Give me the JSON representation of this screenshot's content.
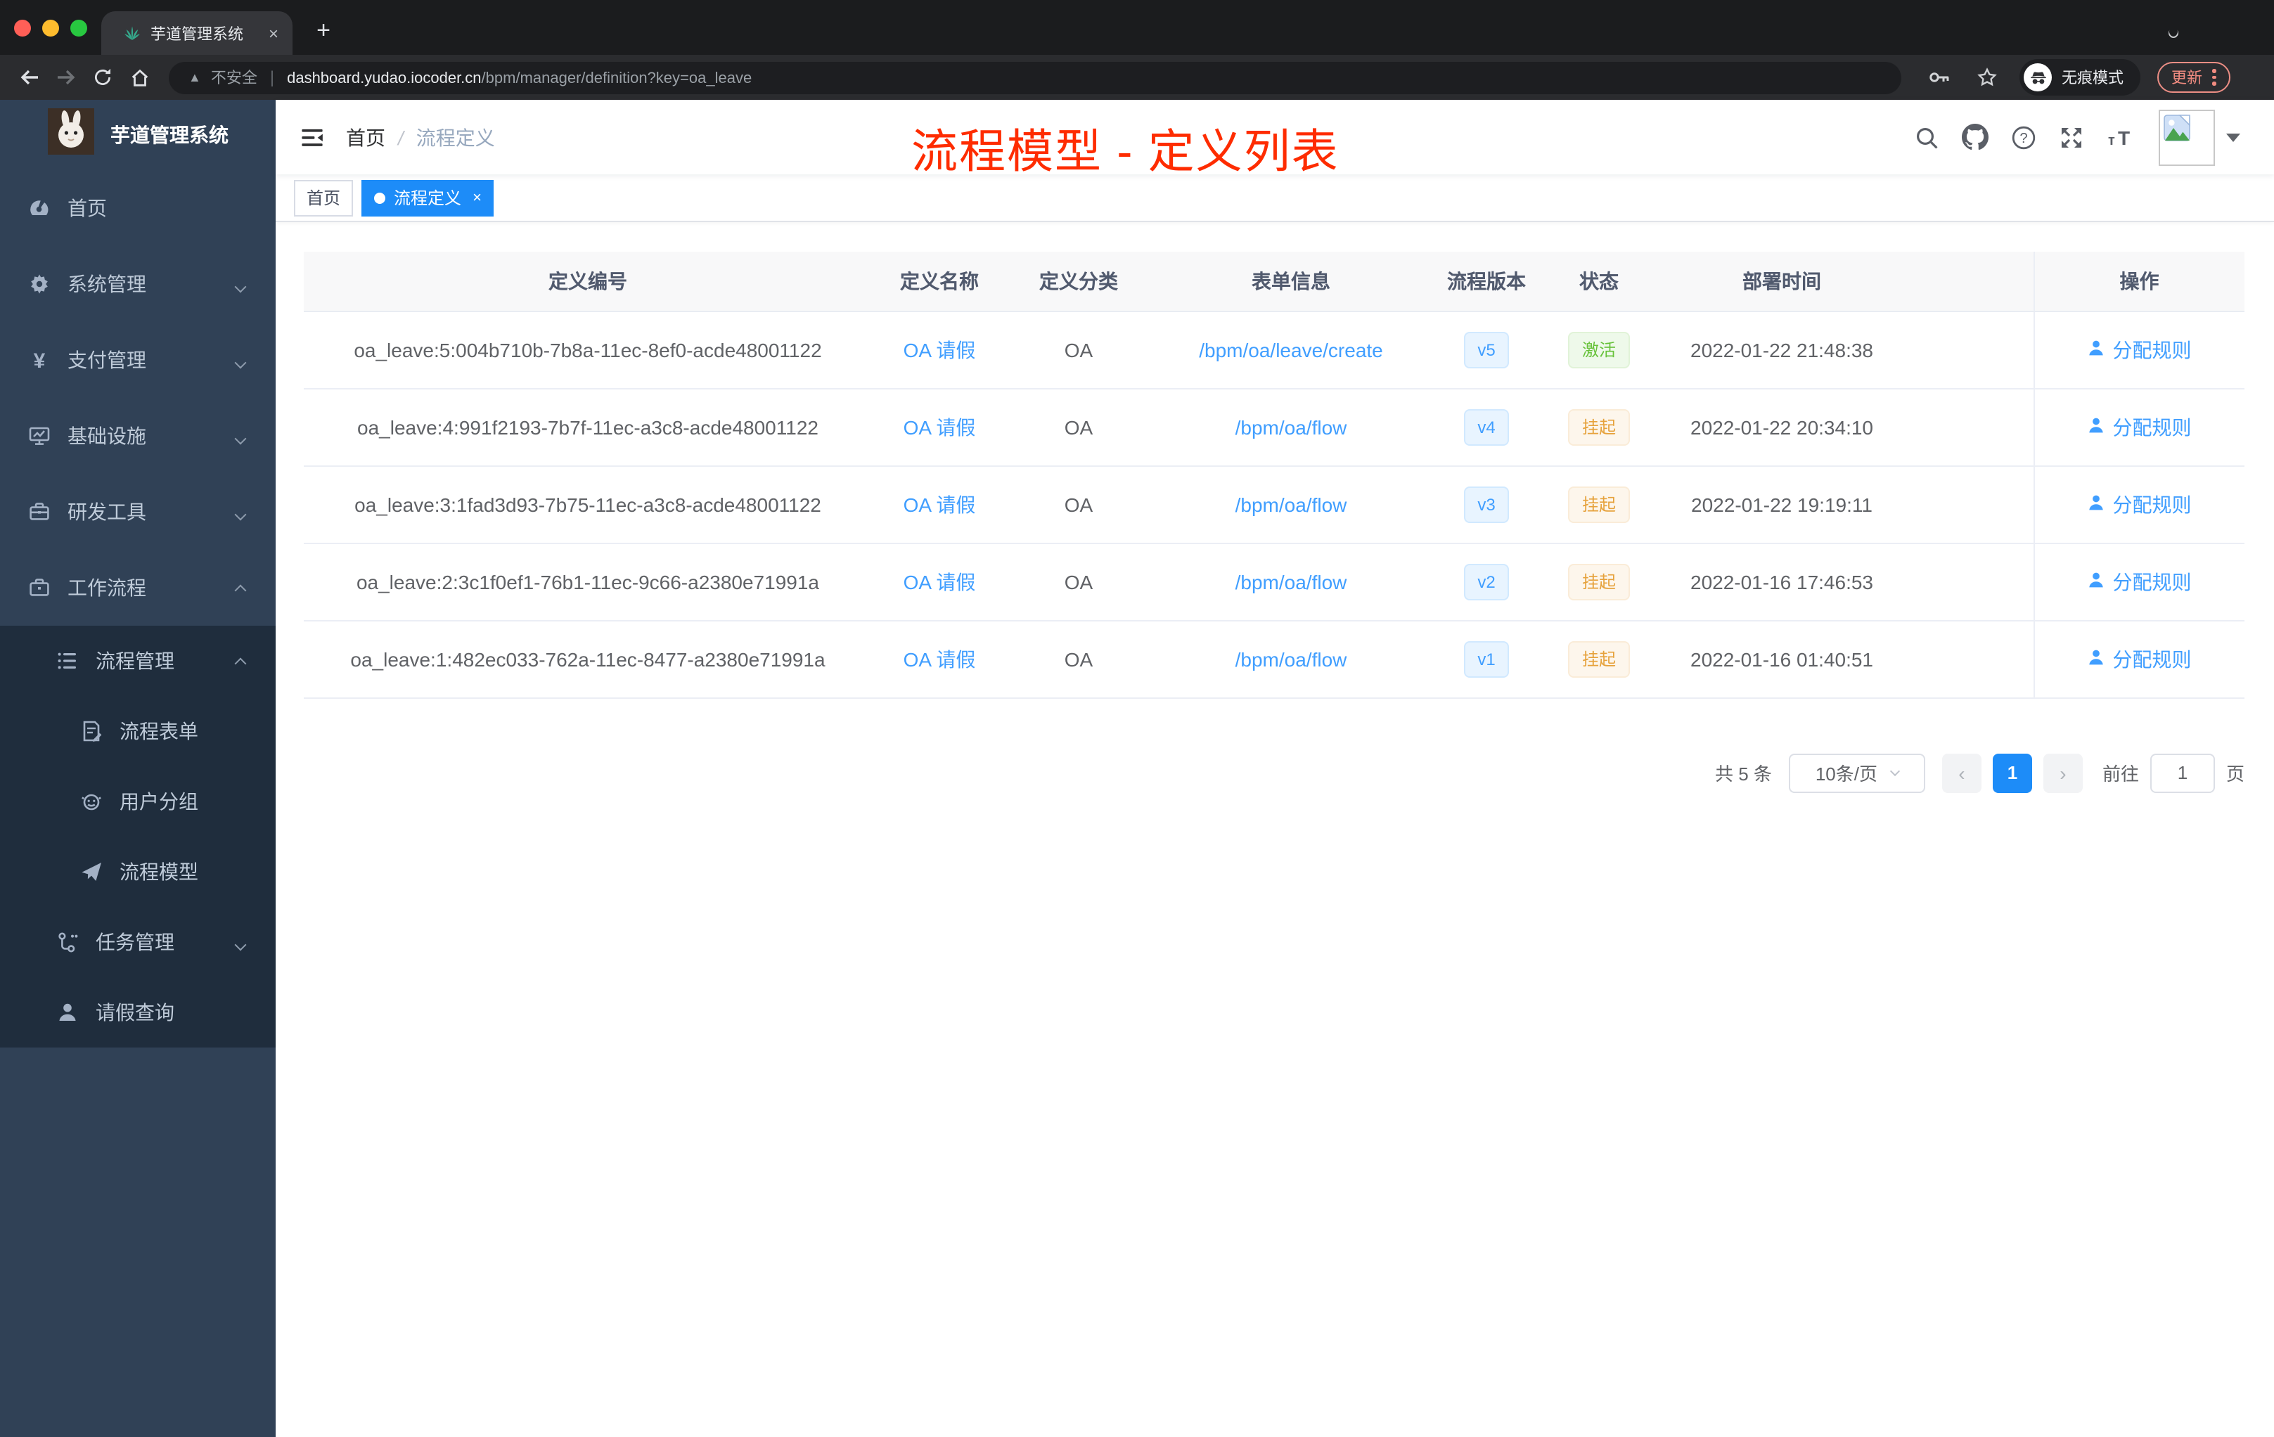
{
  "browser": {
    "tab": {
      "title": "芋道管理系统",
      "close": "×",
      "new_tab": "+"
    },
    "address": {
      "warning_glyph": "▲",
      "security": "不安全",
      "separator": "|",
      "domain": "dashboard.yudao.iocoder.cn",
      "path": "/bpm/manager/definition?key=oa_leave"
    },
    "incognito_label": "无痕模式",
    "update_label": "更新"
  },
  "sidebar": {
    "app_title": "芋道管理系统",
    "items": [
      {
        "label": "首页",
        "icon": "dashboard-icon",
        "level": 1,
        "expand": null,
        "dark": false
      },
      {
        "label": "系统管理",
        "icon": "gear-icon",
        "level": 1,
        "expand": "down",
        "dark": false
      },
      {
        "label": "支付管理",
        "icon": "yen-icon",
        "level": 1,
        "expand": "down",
        "dark": false
      },
      {
        "label": "基础设施",
        "icon": "monitor-icon",
        "level": 1,
        "expand": "down",
        "dark": false
      },
      {
        "label": "研发工具",
        "icon": "toolbox-icon",
        "level": 1,
        "expand": "down",
        "dark": false
      },
      {
        "label": "工作流程",
        "icon": "briefcase-icon",
        "level": 1,
        "expand": "up",
        "dark": false
      },
      {
        "label": "流程管理",
        "icon": "list-tree-icon",
        "level": 2,
        "expand": "up",
        "dark": true
      },
      {
        "label": "流程表单",
        "icon": "form-doc-icon",
        "level": 3,
        "expand": null,
        "dark": true
      },
      {
        "label": "用户分组",
        "icon": "robot-icon",
        "level": 3,
        "expand": null,
        "dark": true
      },
      {
        "label": "流程模型",
        "icon": "paper-plane-icon",
        "level": 3,
        "expand": null,
        "dark": true
      },
      {
        "label": "任务管理",
        "icon": "org-icon",
        "level": 2,
        "expand": "down",
        "dark": true
      },
      {
        "label": "请假查询",
        "icon": "user-icon",
        "level": 2,
        "expand": null,
        "dark": true
      }
    ]
  },
  "navbar": {
    "breadcrumb_home": "首页",
    "breadcrumb_separator": "/",
    "breadcrumb_current": "流程定义"
  },
  "tags": {
    "items": [
      {
        "label": "首页",
        "active": false
      },
      {
        "label": "流程定义",
        "active": true,
        "close": "×"
      }
    ]
  },
  "annotation": {
    "text": "流程模型 - 定义列表",
    "color": "#fe2c00"
  },
  "table": {
    "columns": [
      "定义编号",
      "定义名称",
      "定义分类",
      "表单信息",
      "流程版本",
      "状态",
      "部署时间",
      "操作"
    ],
    "rows": [
      {
        "id": "oa_leave:5:004b710b-7b8a-11ec-8ef0-acde48001122",
        "name": "OA 请假",
        "category": "OA",
        "form": "/bpm/oa/leave/create",
        "version": "v5",
        "status": "激活",
        "status_type": "success",
        "time": "2022-01-22 21:48:38",
        "action": "分配规则"
      },
      {
        "id": "oa_leave:4:991f2193-7b7f-11ec-a3c8-acde48001122",
        "name": "OA 请假",
        "category": "OA",
        "form": "/bpm/oa/flow",
        "version": "v4",
        "status": "挂起",
        "status_type": "warning",
        "time": "2022-01-22 20:34:10",
        "action": "分配规则"
      },
      {
        "id": "oa_leave:3:1fad3d93-7b75-11ec-a3c8-acde48001122",
        "name": "OA 请假",
        "category": "OA",
        "form": "/bpm/oa/flow",
        "version": "v3",
        "status": "挂起",
        "status_type": "warning",
        "time": "2022-01-22 19:19:11",
        "action": "分配规则"
      },
      {
        "id": "oa_leave:2:3c1f0ef1-76b1-11ec-9c66-a2380e71991a",
        "name": "OA 请假",
        "category": "OA",
        "form": "/bpm/oa/flow",
        "version": "v2",
        "status": "挂起",
        "status_type": "warning",
        "time": "2022-01-16 17:46:53",
        "action": "分配规则"
      },
      {
        "id": "oa_leave:1:482ec033-762a-11ec-8477-a2380e71991a",
        "name": "OA 请假",
        "category": "OA",
        "form": "/bpm/oa/flow",
        "version": "v1",
        "status": "挂起",
        "status_type": "warning",
        "time": "2022-01-16 01:40:51",
        "action": "分配规则"
      }
    ]
  },
  "pagination": {
    "total": "共 5 条",
    "page_size": "10条/页",
    "prev": "‹",
    "current_page": "1",
    "next": "›",
    "goto_label": "前往",
    "goto_value": "1",
    "unit": "页"
  },
  "colors": {
    "accent_link": "#409eff",
    "accent_solid": "#1d8cf8",
    "sidebar_bg": "#304156",
    "submenu_bg": "#1f2d3d",
    "success": "#67c23a",
    "warning": "#e6a23c",
    "annotation_red": "#fe2c00"
  }
}
